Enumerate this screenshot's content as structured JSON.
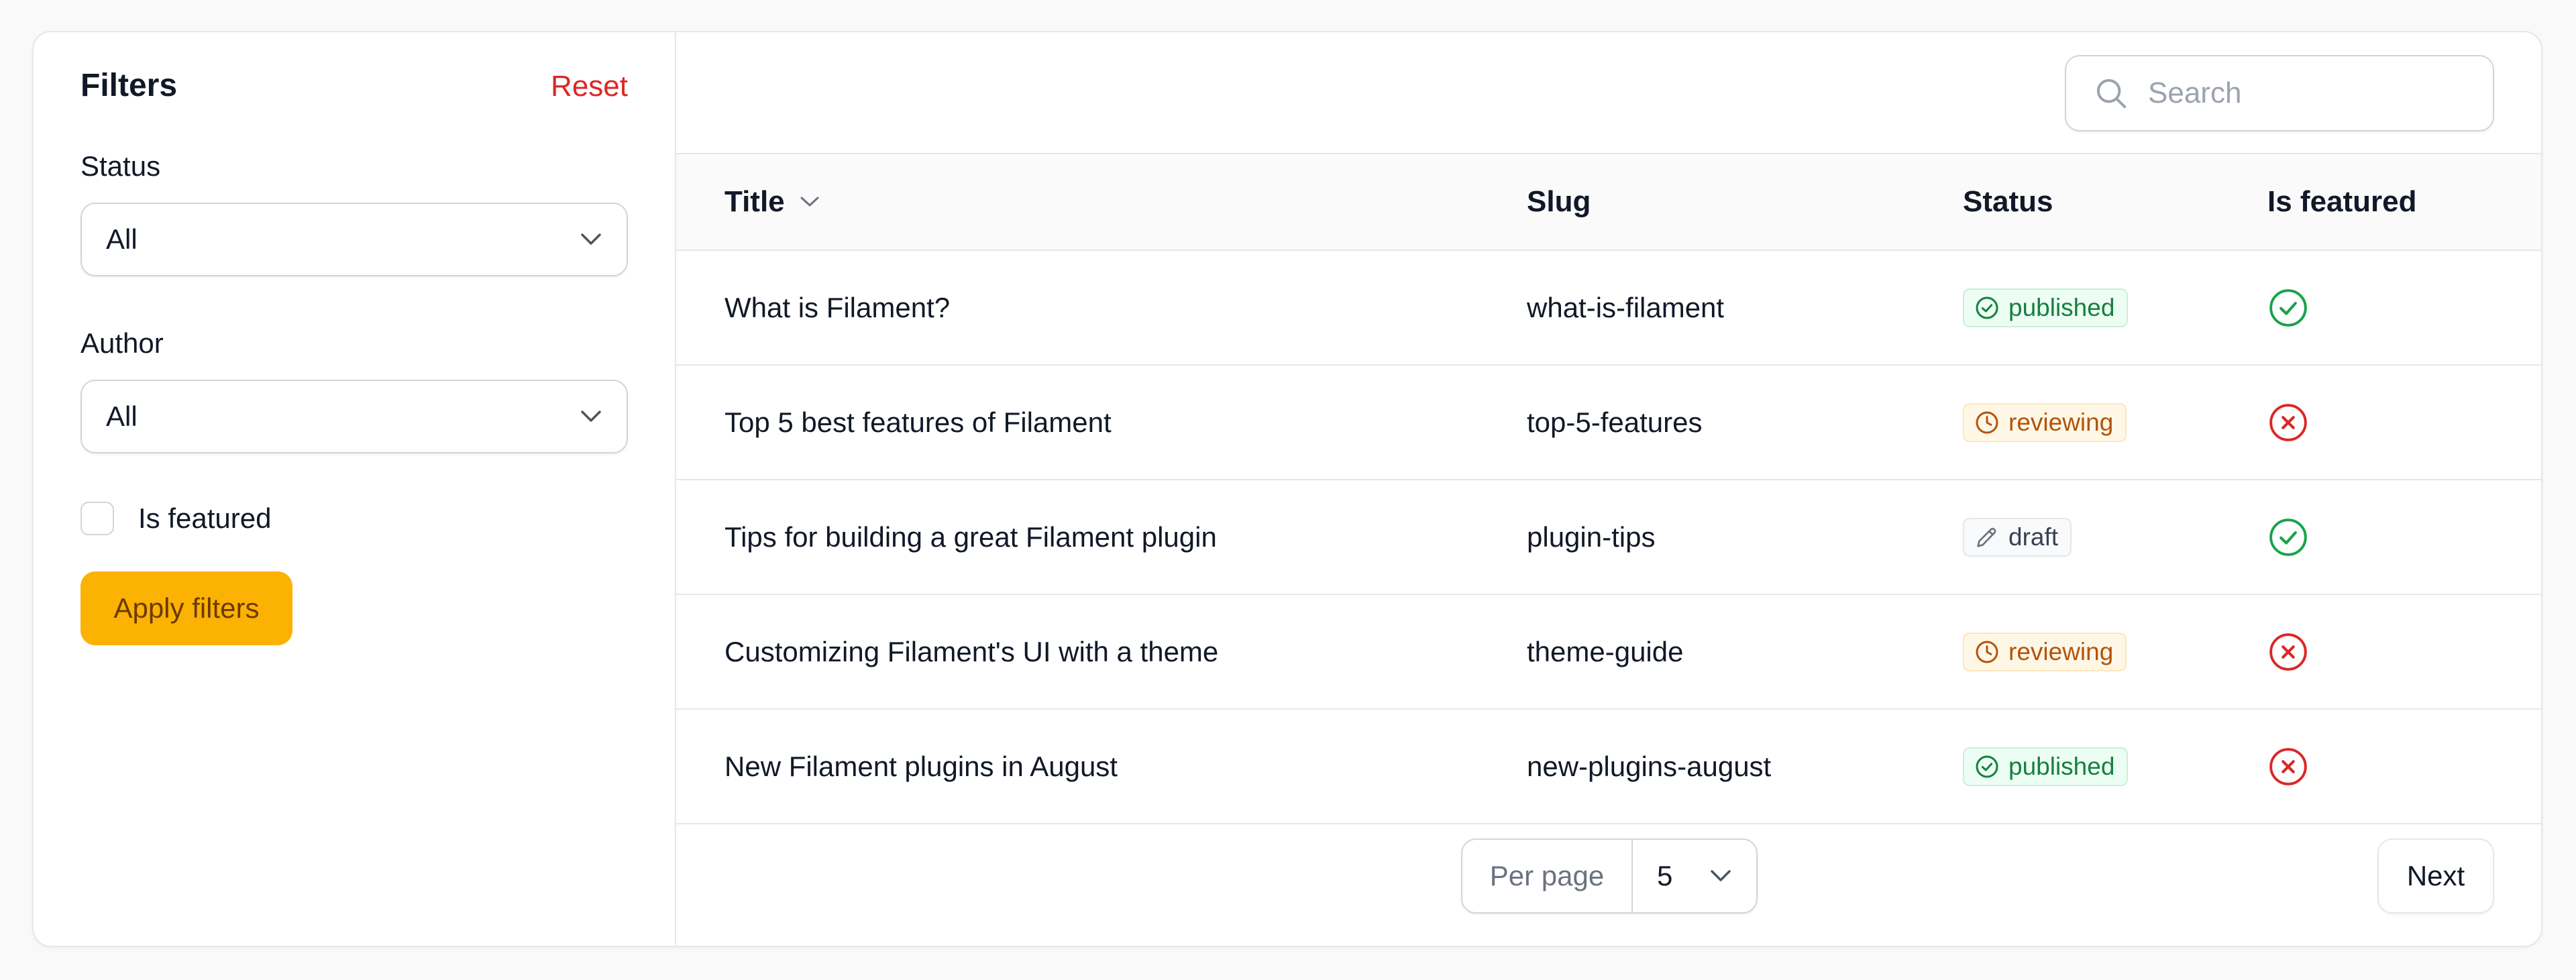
{
  "filters": {
    "title": "Filters",
    "reset_label": "Reset",
    "status": {
      "label": "Status",
      "value": "All"
    },
    "author": {
      "label": "Author",
      "value": "All"
    },
    "is_featured": {
      "label": "Is featured",
      "checked": false
    },
    "apply_label": "Apply filters"
  },
  "search": {
    "placeholder": "Search",
    "value": ""
  },
  "table": {
    "columns": [
      "Title",
      "Slug",
      "Status",
      "Is featured"
    ],
    "rows": [
      {
        "title": "What is Filament?",
        "slug": "what-is-filament",
        "status": "published",
        "featured": true
      },
      {
        "title": "Top 5 best features of Filament",
        "slug": "top-5-features",
        "status": "reviewing",
        "featured": false
      },
      {
        "title": "Tips for building a great Filament plugin",
        "slug": "plugin-tips",
        "status": "draft",
        "featured": true
      },
      {
        "title": "Customizing Filament's UI with a theme",
        "slug": "theme-guide",
        "status": "reviewing",
        "featured": false
      },
      {
        "title": "New Filament plugins in August",
        "slug": "new-plugins-august",
        "status": "published",
        "featured": false
      }
    ]
  },
  "pagination": {
    "per_page_label": "Per page",
    "per_page_value": "5",
    "next_label": "Next"
  },
  "colors": {
    "accent": "#fbb202",
    "reset": "#dc2626",
    "published": "#15803d",
    "reviewing": "#b45309",
    "featured_true": "#16a34a",
    "featured_false": "#dc2626"
  },
  "icons": {
    "published": "check-circle-icon",
    "reviewing": "clock-icon",
    "draft": "pencil-icon",
    "featured_true": "check-circle-icon",
    "featured_false": "x-circle-icon"
  }
}
